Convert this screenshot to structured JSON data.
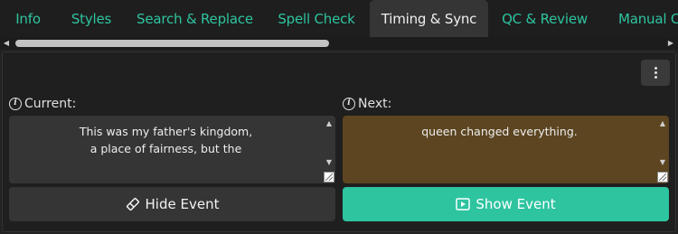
{
  "tabs": [
    {
      "label": "Info",
      "active": false
    },
    {
      "label": "Styles",
      "active": false
    },
    {
      "label": "Search & Replace",
      "active": false
    },
    {
      "label": "Spell Check",
      "active": false
    },
    {
      "label": "Timing & Sync",
      "active": true
    },
    {
      "label": "QC & Review",
      "active": false
    },
    {
      "label": "Manual C",
      "active": false
    }
  ],
  "scrollbar": {
    "left_arrow": "◀",
    "right_arrow": "▶"
  },
  "menu": {
    "icon": "vertical-ellipsis-icon"
  },
  "current": {
    "label": "Current:",
    "text_line1": "This was my father's kingdom,",
    "text_line2": "a place of fairness, but the"
  },
  "next": {
    "label": "Next:",
    "text_line1": "queen changed everything."
  },
  "textbox_scroll": {
    "up": "▲",
    "down": "▼"
  },
  "buttons": {
    "hide_label": "Hide Event",
    "show_label": "Show Event"
  },
  "colors": {
    "accent": "#2ec4a0",
    "next_box_bg": "#5c4520",
    "current_box_bg": "#353535",
    "background": "#222222"
  }
}
